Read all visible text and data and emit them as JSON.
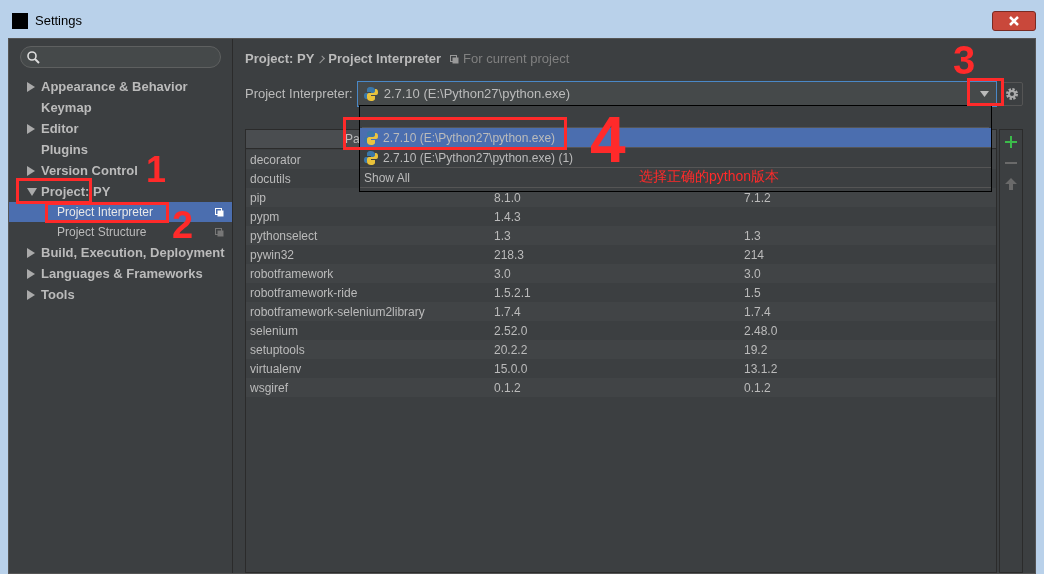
{
  "window": {
    "title": "Settings"
  },
  "sidebar": {
    "items": [
      {
        "label": "Appearance & Behavior",
        "kind": "group",
        "expanded": false
      },
      {
        "label": "Keymap",
        "kind": "page"
      },
      {
        "label": "Editor",
        "kind": "group",
        "expanded": false
      },
      {
        "label": "Plugins",
        "kind": "page"
      },
      {
        "label": "Version Control",
        "kind": "group",
        "expanded": false
      },
      {
        "label": "Project: PY",
        "kind": "group",
        "expanded": true,
        "children": [
          {
            "label": "Project Interpreter",
            "selected": true
          },
          {
            "label": "Project Structure",
            "selected": false
          }
        ]
      },
      {
        "label": "Build, Execution, Deployment",
        "kind": "group",
        "expanded": false
      },
      {
        "label": "Languages & Frameworks",
        "kind": "group",
        "expanded": false
      },
      {
        "label": "Tools",
        "kind": "group",
        "expanded": false
      }
    ]
  },
  "breadcrumb": [
    "Project: PY",
    "Project Interpreter"
  ],
  "scope_note": "For current project",
  "interpreter": {
    "label": "Project Interpreter:",
    "value": "2.7.10 (E:\\Python27\\python.exe)",
    "expanded": true
  },
  "dropdown": {
    "options": [
      {
        "label": "2.7.10 (E:\\Python27\\python.exe)",
        "kind": "interpreter",
        "selected": true
      },
      {
        "label": "2.7.10 (E:\\Python27\\python.exe) (1)",
        "kind": "interpreter",
        "selected": false
      },
      {
        "label": "Show All",
        "kind": "action",
        "selected": false
      }
    ]
  },
  "packages": {
    "header_fragment": "Pa",
    "rows": [
      {
        "package": "decorator"
      },
      {
        "package": "docutils"
      },
      {
        "package": "pip",
        "version": "8.1.0",
        "latest": "7.1.2"
      },
      {
        "package": "pypm",
        "version": "1.4.3"
      },
      {
        "package": "pythonselect",
        "version": "1.3",
        "latest": "1.3"
      },
      {
        "package": "pywin32",
        "version": "218.3",
        "latest": "214"
      },
      {
        "package": "robotframework",
        "version": "3.0",
        "latest": "3.0"
      },
      {
        "package": "robotframework-ride",
        "version": "1.5.2.1",
        "latest": "1.5"
      },
      {
        "package": "robotframework-selenium2library",
        "version": "1.7.4",
        "latest": "1.7.4"
      },
      {
        "package": "selenium",
        "version": "2.52.0",
        "latest": "2.48.0"
      },
      {
        "package": "setuptools",
        "version": "20.2.2",
        "latest": "19.2"
      },
      {
        "package": "virtualenv",
        "version": "15.0.0",
        "latest": "13.1.2"
      },
      {
        "package": "wsgiref",
        "version": "0.1.2",
        "latest": "0.1.2"
      }
    ]
  },
  "annotations": {
    "marks": [
      "1",
      "2",
      "3",
      "4"
    ],
    "note": "选择正确的python版本"
  }
}
